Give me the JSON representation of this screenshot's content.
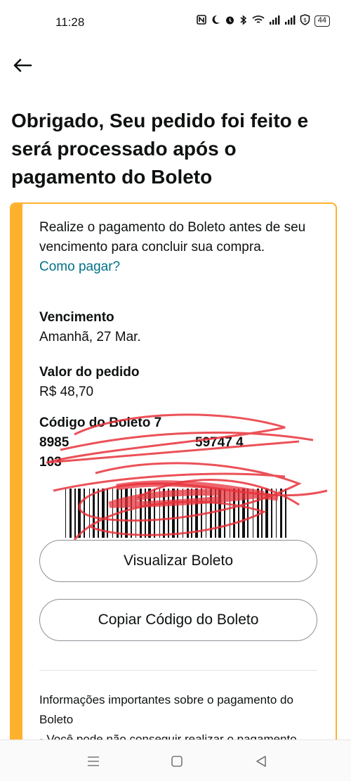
{
  "status_bar": {
    "time": "11:28",
    "battery": "44",
    "icons": [
      "nfc-icon",
      "moon-icon",
      "alarm-icon",
      "bluetooth-icon",
      "wifi-icon",
      "signal-icon",
      "signal-icon",
      "vpn-icon",
      "battery-icon"
    ]
  },
  "header": {
    "title": "Obrigado, Seu pedido foi feito e será processado após o pagamento do Boleto"
  },
  "card": {
    "accent_color": "#ffb12e",
    "intro": "Realize o pagamento do Boleto antes de seu vencimento para concluir sua compra.",
    "help_link": "Como pagar?",
    "due_label": "Vencimento",
    "due_value": "Amanhã, 27 Mar.",
    "amount_label": "Valor do pedido",
    "amount_value": "R$ 48,70",
    "code_line1": "Código do Boleto 7",
    "code_line2": "8985",
    "code_line2_end": "59747 4",
    "code_line3": "103",
    "view_button": "Visualizar Boleto",
    "copy_button": "Copiar Código do Boleto",
    "info_title": "Informações importantes sobre o pagamento do Boleto",
    "info_line": "- Você pode não conseguir realizar o pagamento"
  },
  "link_color": "#007185"
}
